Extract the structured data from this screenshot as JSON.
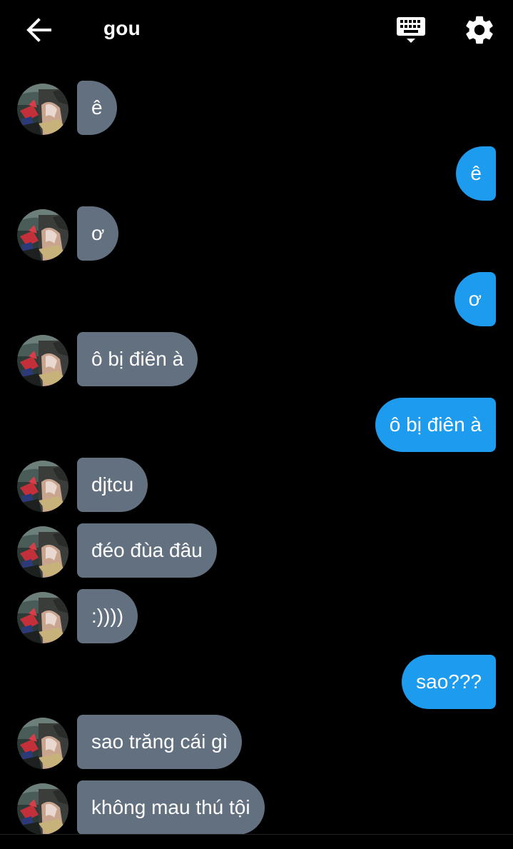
{
  "header": {
    "title": "gou",
    "back_icon": "arrow-left-icon",
    "keyboard_icon": "keyboard-icon",
    "settings_icon": "gear-icon"
  },
  "colors": {
    "background": "#000000",
    "incoming_bubble": "#627080",
    "outgoing_bubble": "#1c9bef"
  },
  "messages": [
    {
      "side": "in",
      "text": "ê"
    },
    {
      "side": "out",
      "text": "ê"
    },
    {
      "side": "in",
      "text": "ơ"
    },
    {
      "side": "out",
      "text": "ơ"
    },
    {
      "side": "in",
      "text": "ô bị điên à"
    },
    {
      "side": "out",
      "text": "ô bị điên à"
    },
    {
      "side": "in",
      "text": "djtcu"
    },
    {
      "side": "in",
      "text": "đéo đùa đâu"
    },
    {
      "side": "in",
      "text": ":))))"
    },
    {
      "side": "out",
      "text": "sao???"
    },
    {
      "side": "in",
      "text": "sao trăng cái gì"
    },
    {
      "side": "in",
      "text": "không mau thú tội"
    }
  ]
}
